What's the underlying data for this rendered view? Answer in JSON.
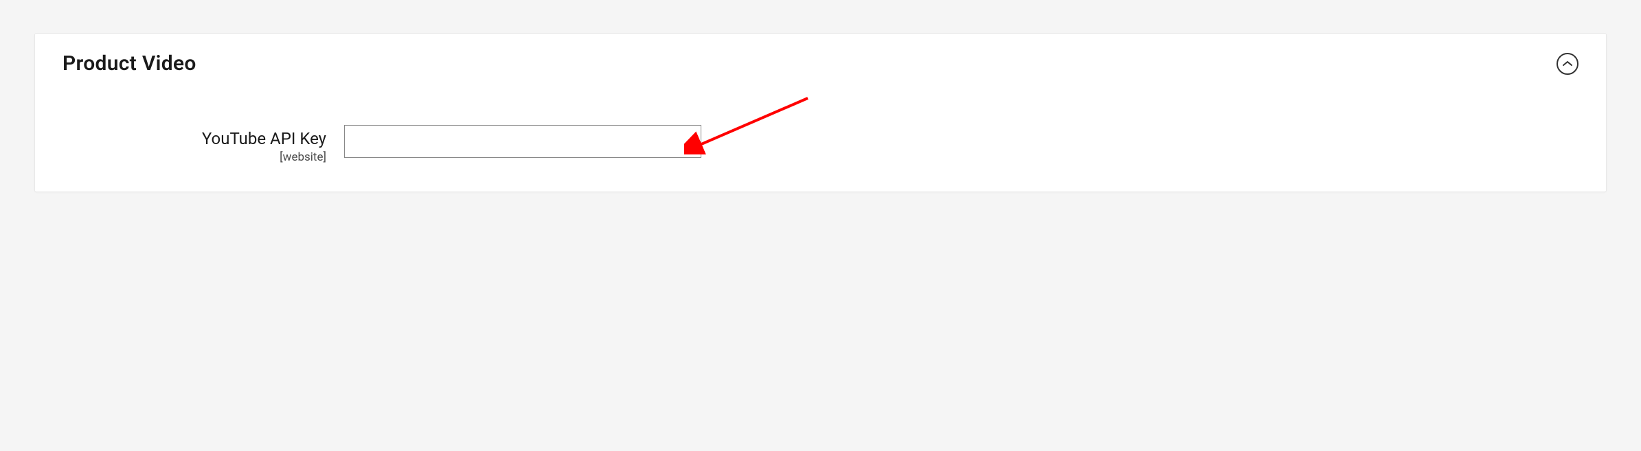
{
  "panel": {
    "title": "Product Video"
  },
  "fields": {
    "youtube_api_key": {
      "label": "YouTube API Key",
      "scope": "[website]",
      "value": ""
    }
  }
}
